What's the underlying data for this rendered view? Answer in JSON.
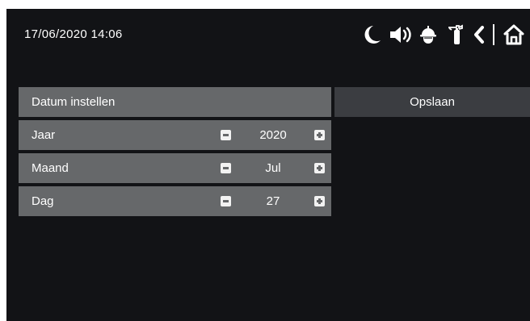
{
  "status_bar": {
    "datetime": "17/06/2020  14:06",
    "icons": [
      "moon-icon",
      "speaker-icon",
      "helmet-icon",
      "fire-extinguisher-icon",
      "back-icon",
      "home-icon"
    ]
  },
  "panel": {
    "title": "Datum instellen",
    "rows": [
      {
        "label": "Jaar",
        "value": "2020"
      },
      {
        "label": "Maand",
        "value": "Jul"
      },
      {
        "label": "Dag",
        "value": "27"
      }
    ]
  },
  "save_button": {
    "label": "Opslaan"
  },
  "colors": {
    "background": "#121316",
    "row": "#66686a",
    "save_button": "#3b3d41",
    "text": "#ffffff"
  }
}
